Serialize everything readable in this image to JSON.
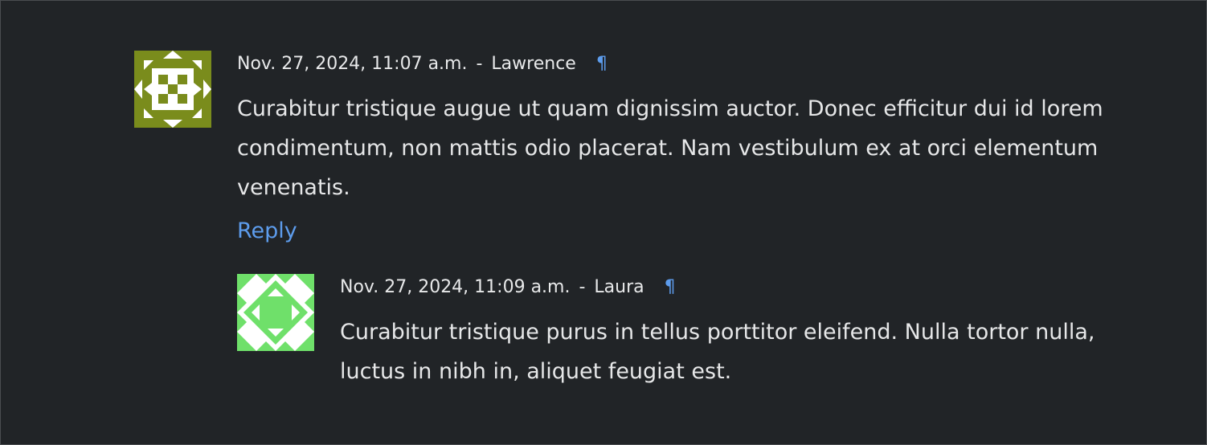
{
  "colors": {
    "background": "#212427",
    "text": "#e6e7e8",
    "link": "#5d9cec"
  },
  "comments": [
    {
      "avatar_icon": "identicon-olive",
      "avatar_colors": {
        "bg": "#7a8c1c",
        "fg": "#ffffff"
      },
      "date": "Nov. 27, 2024, 11:07 a.m.",
      "separator": "-",
      "author": "Lawrence",
      "permalink": "¶",
      "text": "Curabitur tristique augue ut quam dignissim auctor. Donec efficitur dui id lorem condimentum, non mattis odio placerat. Nam vestibulum ex at orci elementum venenatis.",
      "reply_label": "Reply"
    },
    {
      "avatar_icon": "identicon-green",
      "avatar_colors": {
        "bg": "#ffffff",
        "fg": "#6fe06a"
      },
      "date": "Nov. 27, 2024, 11:09 a.m.",
      "separator": "-",
      "author": "Laura",
      "permalink": "¶",
      "text": "Curabitur tristique purus in tellus porttitor eleifend. Nulla tortor nulla, luctus in nibh in, aliquet feugiat est."
    }
  ]
}
